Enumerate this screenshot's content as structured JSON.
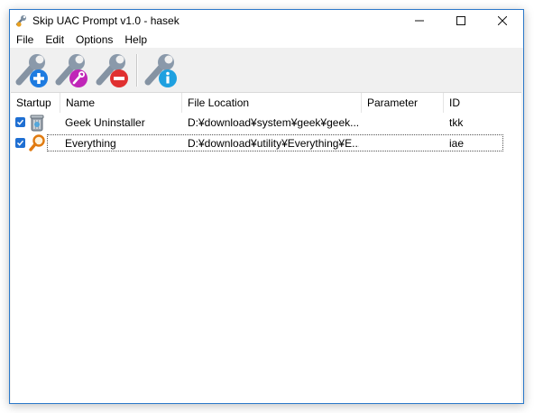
{
  "window": {
    "title": "Skip UAC Prompt v1.0 - hasek"
  },
  "menu": [
    "File",
    "Edit",
    "Options",
    "Help"
  ],
  "toolbar": {
    "buttons": [
      {
        "icon": "wrench-add-icon",
        "accent": "#1e7be0"
      },
      {
        "icon": "wrench-edit-icon",
        "accent": "#c026b8"
      },
      {
        "icon": "wrench-remove-icon",
        "accent": "#e03030"
      },
      {
        "icon": "wrench-info-icon",
        "accent": "#1ea0e0"
      }
    ]
  },
  "list": {
    "columns": [
      "Startup",
      "Name",
      "File Location",
      "Parameter",
      "ID"
    ],
    "rows": [
      {
        "startup": true,
        "icon": "recycle-bin-icon",
        "name": "Geek Uninstaller",
        "location": "D:¥download¥system¥geek¥geek...",
        "parameter": "",
        "id": "tkk"
      },
      {
        "startup": true,
        "icon": "magnifier-icon",
        "name": "Everything",
        "location": "D:¥download¥utility¥Everything¥E...",
        "parameter": "",
        "id": "iae"
      }
    ]
  },
  "colors": {
    "border": "#2b78c9",
    "checkbox": "#1f6fd2"
  }
}
